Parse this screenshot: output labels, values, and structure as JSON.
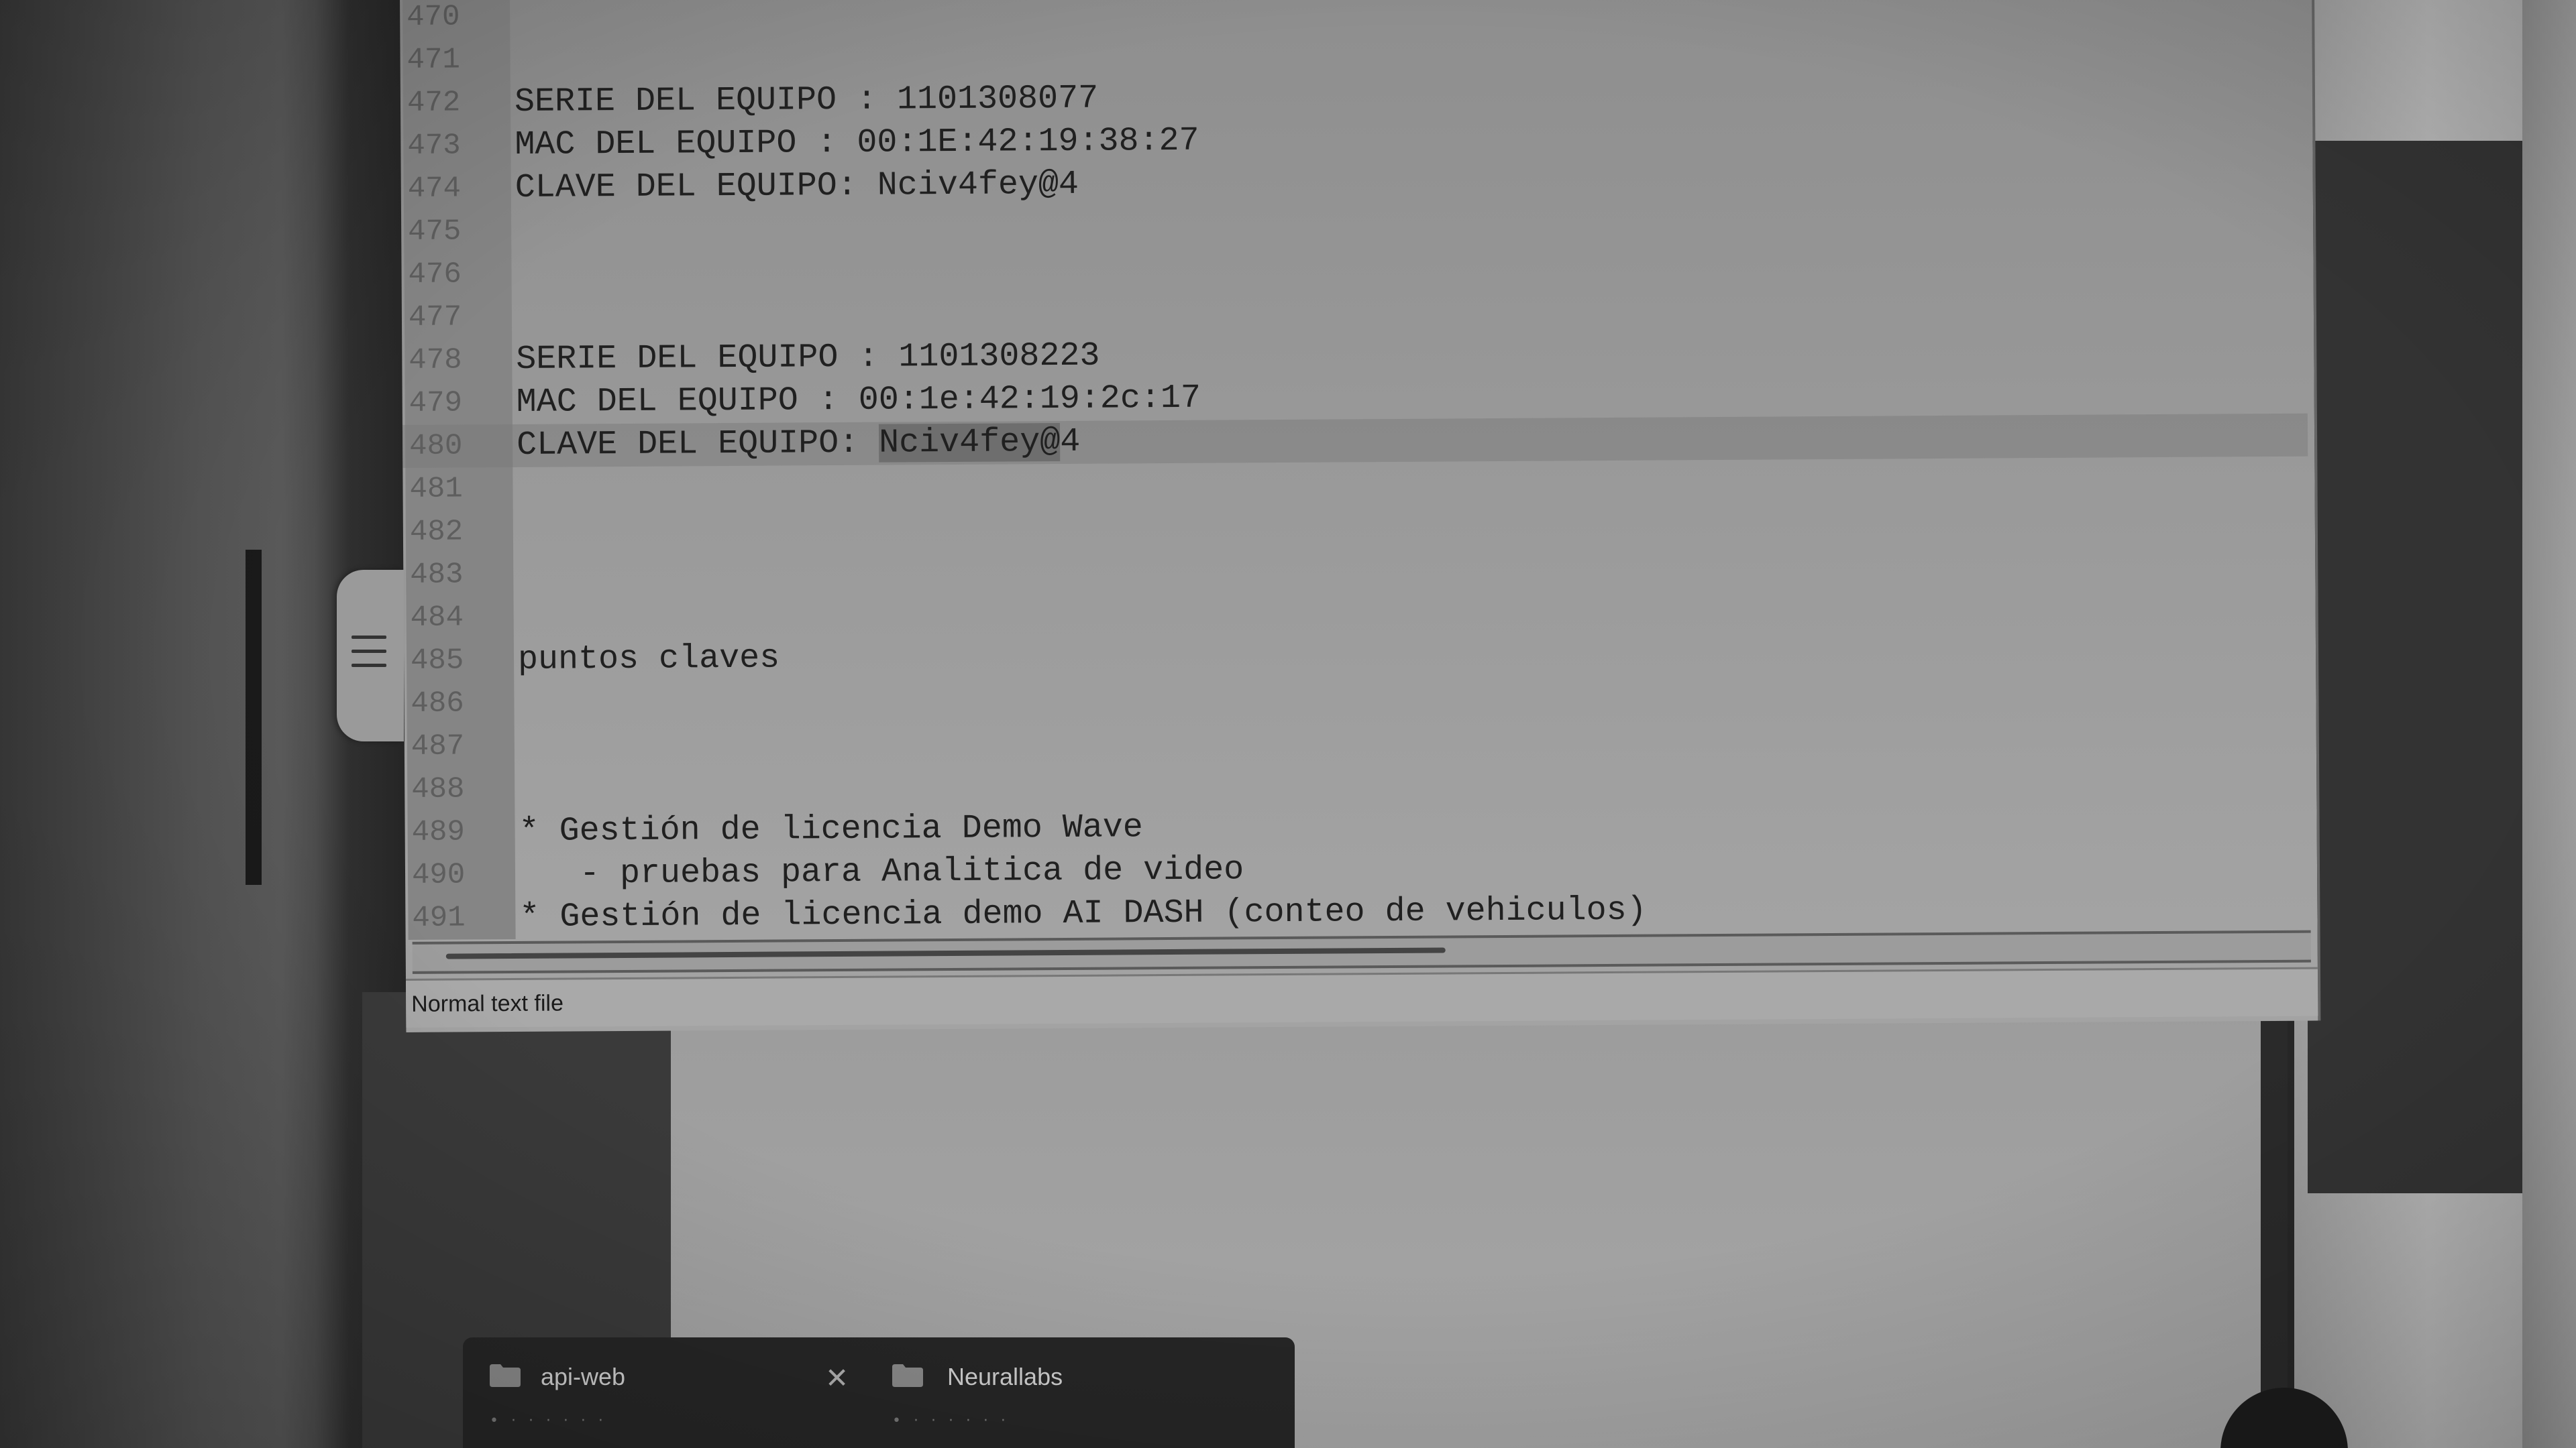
{
  "editor": {
    "lines": [
      {
        "num": "470",
        "text": ""
      },
      {
        "num": "471",
        "text": ""
      },
      {
        "num": "472",
        "text": "SERIE DEL EQUIPO : 1101308077"
      },
      {
        "num": "473",
        "text": "MAC DEL EQUIPO : 00:1E:42:19:38:27"
      },
      {
        "num": "474",
        "text": "CLAVE DEL EQUIPO: Nciv4fey@4"
      },
      {
        "num": "475",
        "text": ""
      },
      {
        "num": "476",
        "text": ""
      },
      {
        "num": "477",
        "text": ""
      },
      {
        "num": "478",
        "text": "SERIE DEL EQUIPO : 1101308223"
      },
      {
        "num": "479",
        "text": "MAC DEL EQUIPO : 00:1e:42:19:2c:17"
      },
      {
        "num": "480",
        "text_prefix": "CLAVE DEL EQUIPO: ",
        "text_selected": "Nciv4fey@",
        "text_suffix": "4"
      },
      {
        "num": "481",
        "text": ""
      },
      {
        "num": "482",
        "text": ""
      },
      {
        "num": "483",
        "text": ""
      },
      {
        "num": "484",
        "text": ""
      },
      {
        "num": "485",
        "text": "puntos claves"
      },
      {
        "num": "486",
        "text": ""
      },
      {
        "num": "487",
        "text": ""
      },
      {
        "num": "488",
        "text": ""
      },
      {
        "num": "489",
        "text": "* Gestión de licencia Demo Wave"
      },
      {
        "num": "490",
        "text": "   - pruebas para Analitica de video"
      },
      {
        "num": "491",
        "text": "* Gestión de licencia demo AI DASH (conteo de vehiculos)"
      }
    ]
  },
  "statusbar": {
    "file_type": "Normal text file"
  },
  "taskbar": {
    "tabs": [
      {
        "label": "api-web",
        "icon": "folder-icon",
        "dots": "• · · · · · ·"
      },
      {
        "label": "Neurallabs",
        "icon": "folder-icon",
        "dots": "• · · · · · ·"
      }
    ],
    "close_glyph": "✕"
  },
  "side_handle": {
    "icon": "menu-icon"
  }
}
